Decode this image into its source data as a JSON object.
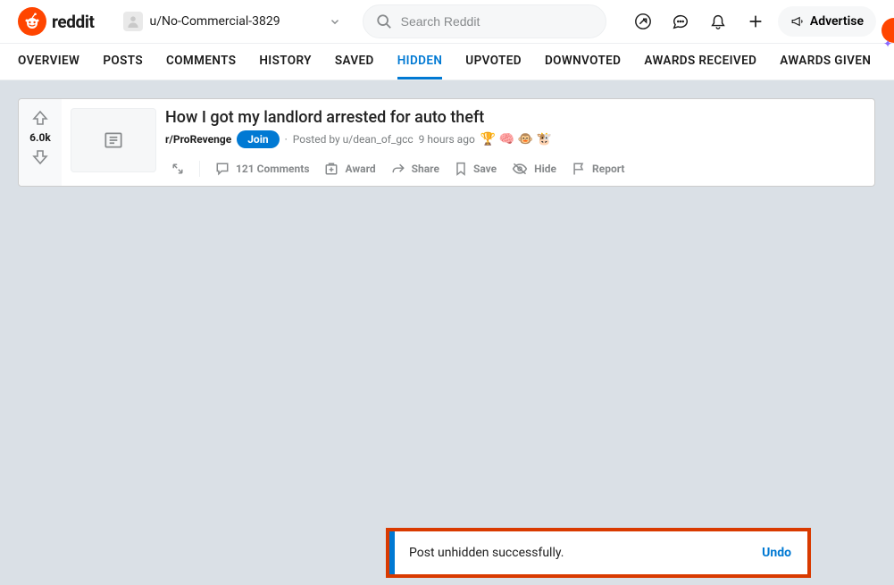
{
  "header": {
    "brand": "reddit",
    "username": "u/No-Commercial-3829",
    "search_placeholder": "Search Reddit",
    "advertise_label": "Advertise"
  },
  "tabs": [
    {
      "label": "OVERVIEW",
      "active": false
    },
    {
      "label": "POSTS",
      "active": false
    },
    {
      "label": "COMMENTS",
      "active": false
    },
    {
      "label": "HISTORY",
      "active": false
    },
    {
      "label": "SAVED",
      "active": false
    },
    {
      "label": "HIDDEN",
      "active": true
    },
    {
      "label": "UPVOTED",
      "active": false
    },
    {
      "label": "DOWNVOTED",
      "active": false
    },
    {
      "label": "AWARDS RECEIVED",
      "active": false
    },
    {
      "label": "AWARDS GIVEN",
      "active": false
    }
  ],
  "post": {
    "score": "6.0k",
    "title": "How I got my landlord arrested for auto theft",
    "subreddit": "r/ProRevenge",
    "join_label": "Join",
    "posted_by_prefix": "Posted by ",
    "author": "u/dean_of_gcc",
    "time": "9 hours ago",
    "emojis": "🏆 🧠 🐵 🐮",
    "actions": {
      "comments": "121 Comments",
      "award": "Award",
      "share": "Share",
      "save": "Save",
      "hide": "Hide",
      "report": "Report"
    }
  },
  "toast": {
    "message": "Post unhidden successfully.",
    "undo_label": "Undo"
  }
}
